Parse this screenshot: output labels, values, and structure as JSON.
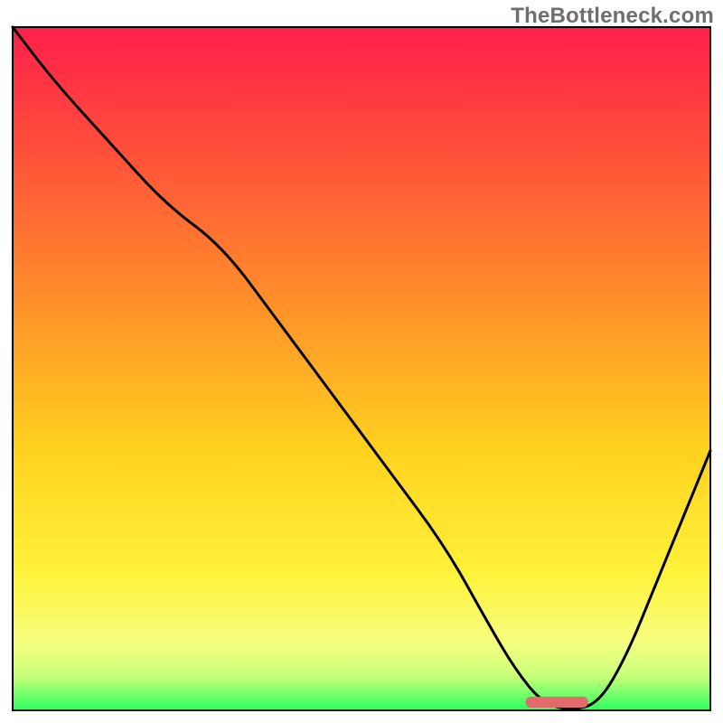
{
  "watermark": "TheBottleneck.com",
  "chart_data": {
    "type": "line",
    "title": "",
    "xlabel": "",
    "ylabel": "",
    "xlim": [
      0,
      100
    ],
    "ylim": [
      0,
      100
    ],
    "axes_visible": false,
    "background": {
      "description": "vertical gradient red→orange→yellow→green (bottleneck-style heat band)",
      "stops": [
        {
          "offset": 0.0,
          "color": "#ff1f4b"
        },
        {
          "offset": 0.18,
          "color": "#ff4f3a"
        },
        {
          "offset": 0.4,
          "color": "#ff8f2a"
        },
        {
          "offset": 0.62,
          "color": "#ffd21f"
        },
        {
          "offset": 0.8,
          "color": "#fff23a"
        },
        {
          "offset": 0.9,
          "color": "#f7ff80"
        },
        {
          "offset": 0.95,
          "color": "#c8ff7a"
        },
        {
          "offset": 1.0,
          "color": "#2bff60"
        }
      ]
    },
    "series": [
      {
        "name": "bottleneck-curve",
        "stroke": "#000000",
        "x": [
          0,
          6,
          14,
          22,
          30,
          38,
          46,
          54,
          62,
          68,
          72,
          76,
          80,
          84,
          88,
          92,
          96,
          100
        ],
        "y": [
          100,
          92,
          83,
          74,
          68,
          57,
          46,
          35,
          24,
          13,
          6,
          1,
          0,
          1,
          8,
          18,
          28,
          38
        ]
      }
    ],
    "marker": {
      "name": "sweet-spot-bar",
      "shape": "rounded-rect",
      "color": "#e26a6a",
      "x_center": 78,
      "y_center": 1.2,
      "width": 9,
      "height": 1.6
    }
  }
}
